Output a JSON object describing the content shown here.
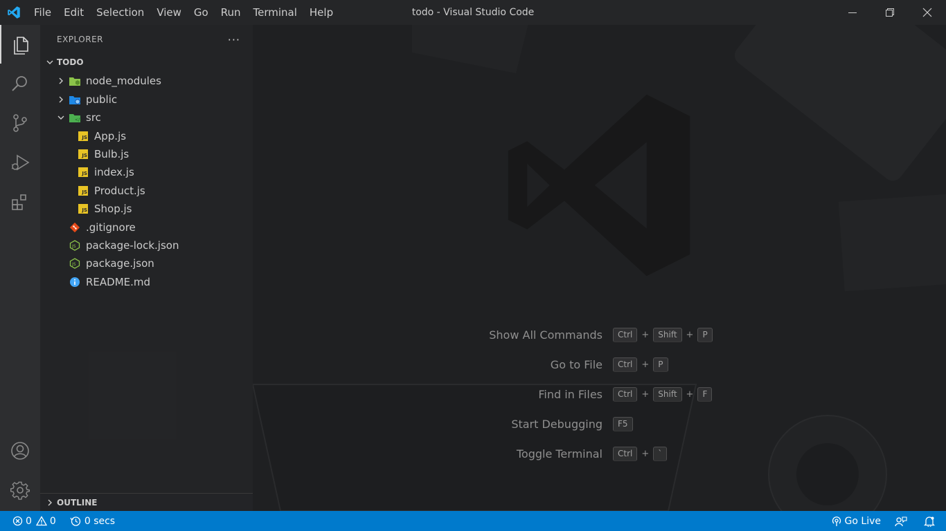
{
  "titlebar": {
    "menu": [
      "File",
      "Edit",
      "Selection",
      "View",
      "Go",
      "Run",
      "Terminal",
      "Help"
    ],
    "window_title": "todo - Visual Studio Code"
  },
  "activitybar": {
    "icons": [
      "files-icon",
      "search-icon",
      "source-control-icon",
      "run-debug-icon",
      "extensions-icon",
      "account-icon",
      "settings-gear-icon"
    ]
  },
  "sidebar": {
    "header": "EXPLORER",
    "more": "···",
    "root": "TODO",
    "tree": [
      {
        "label": "node_modules",
        "kind": "folder",
        "icon": "folder-node-icon",
        "expanded": false,
        "depth": 1
      },
      {
        "label": "public",
        "kind": "folder",
        "icon": "folder-public-icon",
        "expanded": false,
        "depth": 1
      },
      {
        "label": "src",
        "kind": "folder",
        "icon": "folder-src-icon",
        "expanded": true,
        "depth": 1
      },
      {
        "label": "App.js",
        "kind": "file",
        "icon": "javascript-icon",
        "depth": 2
      },
      {
        "label": "Bulb.js",
        "kind": "file",
        "icon": "javascript-icon",
        "depth": 2
      },
      {
        "label": "index.js",
        "kind": "file",
        "icon": "javascript-icon",
        "depth": 2
      },
      {
        "label": "Product.js",
        "kind": "file",
        "icon": "javascript-icon",
        "depth": 2
      },
      {
        "label": "Shop.js",
        "kind": "file",
        "icon": "javascript-icon",
        "depth": 2
      },
      {
        "label": ".gitignore",
        "kind": "file",
        "icon": "git-icon",
        "depth": 1
      },
      {
        "label": "package-lock.json",
        "kind": "file",
        "icon": "nodejs-icon",
        "depth": 1
      },
      {
        "label": "package.json",
        "kind": "file",
        "icon": "nodejs-icon",
        "depth": 1
      },
      {
        "label": "README.md",
        "kind": "file",
        "icon": "info-icon",
        "depth": 1
      }
    ],
    "outline": "OUTLINE"
  },
  "editor": {
    "shortcuts": [
      {
        "label": "Show All Commands",
        "keys": [
          "Ctrl",
          "Shift",
          "P"
        ]
      },
      {
        "label": "Go to File",
        "keys": [
          "Ctrl",
          "P"
        ]
      },
      {
        "label": "Find in Files",
        "keys": [
          "Ctrl",
          "Shift",
          "F"
        ]
      },
      {
        "label": "Start Debugging",
        "keys": [
          "F5"
        ]
      },
      {
        "label": "Toggle Terminal",
        "keys": [
          "Ctrl",
          "`"
        ]
      }
    ]
  },
  "statusbar": {
    "errors": "0",
    "warnings": "0",
    "timer": "0 secs",
    "go_live": "Go Live"
  },
  "colors": {
    "statusbar": "#007acc",
    "vscode_blue": "#23a9f2",
    "js_yellow": "#e8c325"
  }
}
